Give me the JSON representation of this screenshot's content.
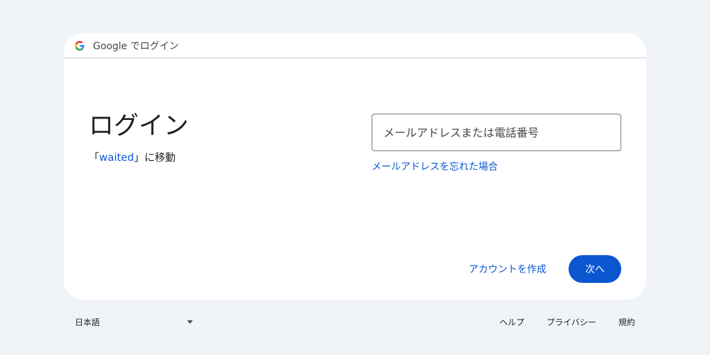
{
  "header": {
    "logo_icon": "google-g-icon",
    "text": "Google でログイン"
  },
  "main": {
    "title": "ログイン",
    "subtitle_prefix": "「",
    "subtitle_site": "waited",
    "subtitle_suffix": "」に移動"
  },
  "form": {
    "email_placeholder": "メールアドレスまたは電話番号",
    "email_value": "",
    "forgot_email_link": "メールアドレスを忘れた場合"
  },
  "actions": {
    "create_account": "アカウントを作成",
    "next": "次へ"
  },
  "footer": {
    "language": "日本語",
    "links": [
      "ヘルプ",
      "プライバシー",
      "規約"
    ]
  },
  "colors": {
    "background": "#f0f4f9",
    "card": "#ffffff",
    "accent": "#0b57d0"
  }
}
